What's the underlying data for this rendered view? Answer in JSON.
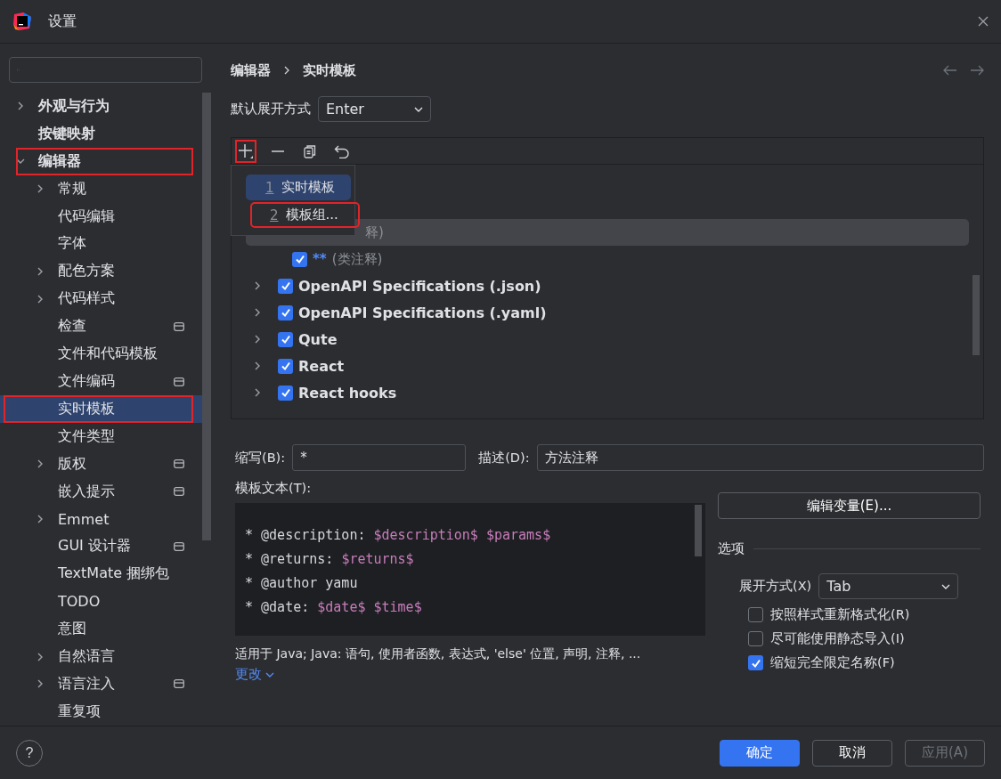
{
  "window": {
    "title": "设置"
  },
  "help": "?",
  "sidebar": {
    "items": [
      {
        "label": "外观与行为",
        "expanded": false,
        "selected": false
      },
      {
        "label": "按键映射",
        "selected": false
      },
      {
        "label": "编辑器",
        "expanded": true,
        "selected": false,
        "highlighted": true,
        "children": [
          {
            "label": "常规",
            "expanded": false,
            "selected": false
          },
          {
            "label": "代码编辑",
            "selected": false
          },
          {
            "label": "字体",
            "selected": false
          },
          {
            "label": "配色方案",
            "expanded": false,
            "selected": false
          },
          {
            "label": "代码样式",
            "expanded": false,
            "selected": false
          },
          {
            "label": "检查",
            "selected": false,
            "scoped": true
          },
          {
            "label": "文件和代码模板",
            "selected": false
          },
          {
            "label": "文件编码",
            "selected": false,
            "scoped": true
          },
          {
            "label": "实时模板",
            "selected": true,
            "highlighted": true
          },
          {
            "label": "文件类型",
            "selected": false
          },
          {
            "label": "版权",
            "expanded": false,
            "selected": false,
            "scoped": true
          },
          {
            "label": "嵌入提示",
            "selected": false,
            "scoped": true
          },
          {
            "label": "Emmet",
            "expanded": false,
            "selected": false
          },
          {
            "label": "GUI 设计器",
            "selected": false,
            "scoped": true
          },
          {
            "label": "TextMate 捆绑包",
            "selected": false
          },
          {
            "label": "TODO",
            "selected": false
          },
          {
            "label": "意图",
            "selected": false
          },
          {
            "label": "自然语言",
            "expanded": false,
            "selected": false
          },
          {
            "label": "语言注入",
            "expanded": false,
            "selected": false,
            "scoped": true
          },
          {
            "label": "重复项",
            "selected": false
          }
        ]
      }
    ]
  },
  "breadcrumb": [
    "编辑器",
    "实时模板"
  ],
  "default_expand": {
    "label": "默认展开方式",
    "value": "Enter"
  },
  "toolbar": [
    {
      "kind": "add",
      "highlighted": true
    },
    {
      "kind": "remove",
      "highlighted": false
    },
    {
      "kind": "copy",
      "highlighted": false
    },
    {
      "kind": "undo",
      "highlighted": false
    }
  ],
  "add_menu": [
    {
      "number": "1",
      "label": "实时模板",
      "selected": true,
      "highlighted": false
    },
    {
      "number": "2",
      "label": "模板组...",
      "selected": false,
      "highlighted": true
    }
  ],
  "templates": [
    {
      "kind": "template",
      "description": "释)",
      "selected": true
    },
    {
      "kind": "template",
      "abbreviation": "**",
      "description": "(类注释)",
      "checked": true,
      "selected": false
    },
    {
      "kind": "group",
      "name": "OpenAPI Specifications (.json)",
      "checked": true,
      "selected": false
    },
    {
      "kind": "group",
      "name": "OpenAPI Specifications (.yaml)",
      "checked": true,
      "selected": false
    },
    {
      "kind": "group",
      "name": "Qute",
      "checked": true,
      "selected": false
    },
    {
      "kind": "group",
      "name": "React",
      "checked": true,
      "selected": false
    },
    {
      "kind": "group",
      "name": "React hooks",
      "checked": true,
      "selected": false
    }
  ],
  "abbreviation": {
    "label": "缩写(B):",
    "value": "*"
  },
  "description": {
    "label": "描述(D):",
    "value": "方法注释"
  },
  "template_text": {
    "label": "模板文本(T):",
    "lines": [
      [
        {
          "kind": "plain",
          "text": "* @description: "
        },
        {
          "kind": "variable",
          "text": "$description$"
        },
        {
          "kind": "variable",
          "text": "$params$"
        }
      ],
      [
        {
          "kind": "plain",
          "text": "* @returns: "
        },
        {
          "kind": "variable",
          "text": "$returns$"
        }
      ],
      [
        {
          "kind": "plain",
          "text": "* @author yamu"
        }
      ],
      [
        {
          "kind": "plain",
          "text": "* @date: "
        },
        {
          "kind": "variable",
          "text": "$date$"
        },
        {
          "kind": "variable",
          "text": "$time$"
        }
      ]
    ]
  },
  "applicable": "适用于 Java; Java: 语句, 使用者函数, 表达式, 'else' 位置, 声明, 注释, ...",
  "change_link": "更改",
  "edit_variables": "编辑变量(E)...",
  "options": {
    "title": "选项",
    "expand_label": "展开方式(X)",
    "expand_value": "Tab",
    "checks": [
      {
        "label": "按照样式重新格式化(R)",
        "checked": false
      },
      {
        "label": "尽可能使用静态导入(I)",
        "checked": false
      },
      {
        "label": "缩短完全限定名称(F)",
        "checked": true
      }
    ]
  },
  "buttons": [
    {
      "label": "确定",
      "kind": "primary",
      "disabled": false
    },
    {
      "label": "取消",
      "kind": "normal",
      "disabled": false
    },
    {
      "label": "应用(A)",
      "kind": "normal",
      "disabled": true
    }
  ]
}
